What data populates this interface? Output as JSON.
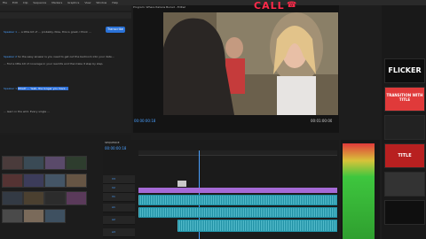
{
  "menu": {
    "items": [
      "File",
      "Edit",
      "Clip",
      "Sequence",
      "Markers",
      "Graphics",
      "View",
      "Window",
      "Help"
    ]
  },
  "overlay": {
    "call_text": "CALL",
    "phone_icon": "phone-icon",
    "color": "#ff2a4a"
  },
  "viewer": {
    "title": "Program: Where Italians Buried - Edited",
    "timecode_left": "00:00:00:18",
    "timecode_right": "00:01:00:00"
  },
  "transcript": {
    "transcribe_label": "Transcribe",
    "lines": [
      {
        "speaker": "Speaker 1",
        "text": "... a little bit of ... probably. Now, this is great, I think ..."
      },
      {
        "speaker": "Speaker 2",
        "text": "So the easy answer is you need to get out the bedroom into your data..."
      },
      {
        "speaker": "",
        "text": "... find a little bit of coverage in your real life and then take it step by step."
      },
      {
        "speaker": "Speaker 1",
        "text": "What? ... Yeah, the longer you have ..."
      },
      {
        "speaker": "",
        "text": "... learn in the wild. Every single ..."
      }
    ]
  },
  "timeline": {
    "sequence_name": "SEQUENCE",
    "timecode": "00:00:00:18",
    "tracks": [
      "V3",
      "V2",
      "V1",
      "A1",
      "A2",
      "A3"
    ]
  },
  "right_panel": {
    "presets": [
      "FLICKER",
      "TRANSITION WITH TITLE",
      "",
      "TITLE",
      "",
      ""
    ]
  },
  "colors": {
    "accent": "#2a72d8",
    "video_clip": "#a56ad6",
    "audio_clip": "#1f8fa3",
    "meter_green": "#3ec63e",
    "meter_red": "#e03a3a"
  }
}
